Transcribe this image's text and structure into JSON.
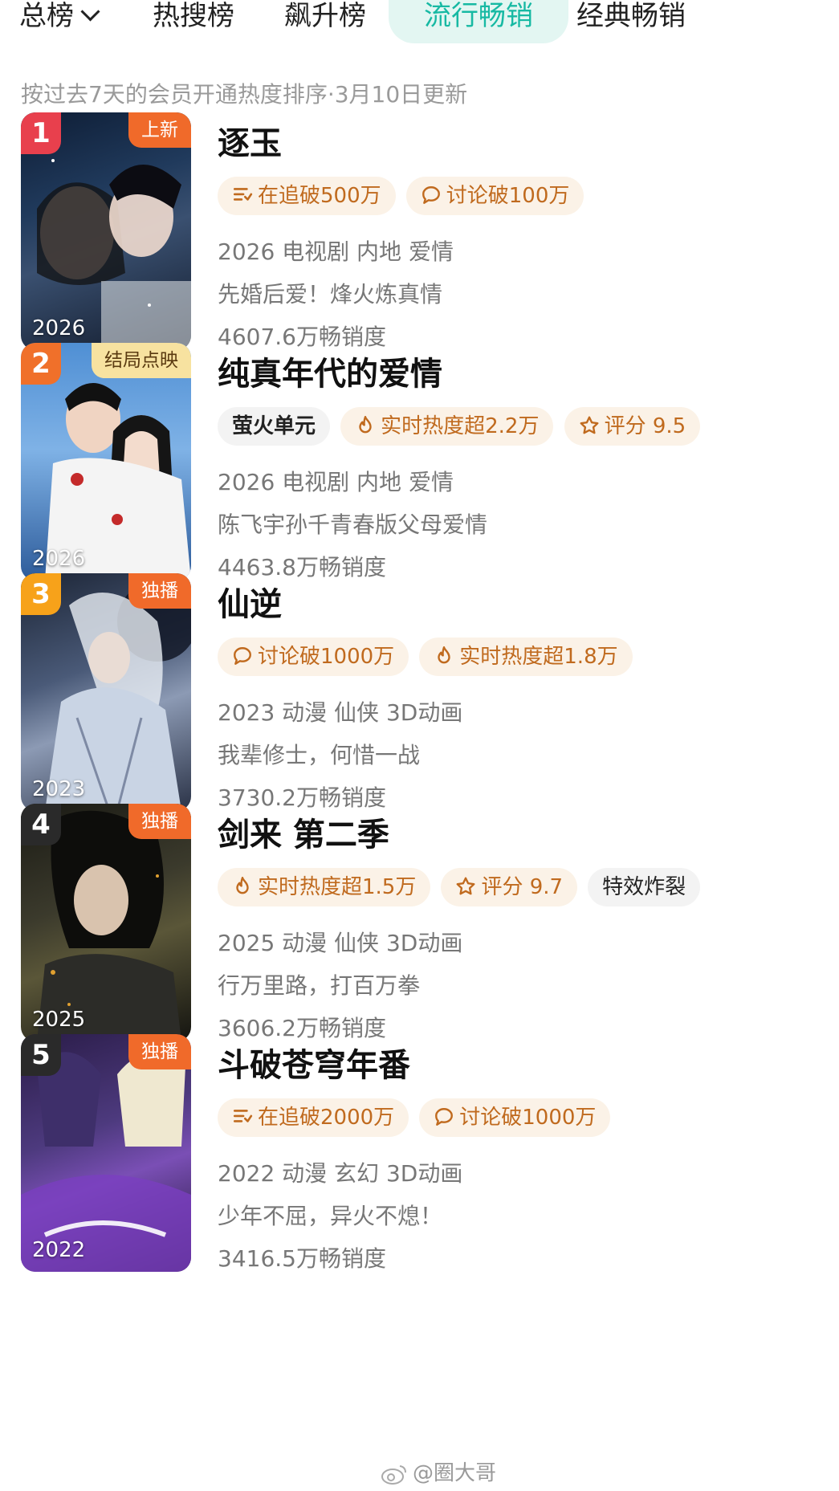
{
  "tabs": {
    "main": "总榜",
    "items": [
      "热搜榜",
      "飙升榜",
      "流行畅销",
      "经典畅销"
    ],
    "active": "流行畅销"
  },
  "subtitle": "按过去7天的会员开通热度排序·3月10日更新",
  "ranking": [
    {
      "rank": "1",
      "badge": "上新",
      "year": "2026",
      "title": "逐玉",
      "chips": [
        {
          "icon": "list-icon",
          "text": "在追破500万"
        },
        {
          "icon": "comment-icon",
          "text": "讨论破100万"
        }
      ],
      "info": "2026 电视剧 内地 爱情",
      "desc": "先婚后爱！烽火炼真情",
      "sales": "4607.6万畅销度"
    },
    {
      "rank": "2",
      "badge": "结局点映",
      "year": "2026",
      "title": "纯真年代的爱情",
      "chips": [
        {
          "icon": "yinghuo-logo-icon",
          "text": "萤火单元"
        },
        {
          "icon": "flame-icon",
          "text": "实时热度超2.2万"
        },
        {
          "icon": "star-icon",
          "text": "评分 9.5"
        }
      ],
      "info": "2026 电视剧 内地 爱情",
      "desc": "陈飞宇孙千青春版父母爱情",
      "sales": "4463.8万畅销度"
    },
    {
      "rank": "3",
      "badge": "独播",
      "year": "2023",
      "title": "仙逆",
      "chips": [
        {
          "icon": "comment-icon",
          "text": "讨论破1000万"
        },
        {
          "icon": "flame-icon",
          "text": "实时热度超1.8万"
        }
      ],
      "info": "2023 动漫 仙侠 3D动画",
      "desc": "我辈修士，何惜一战",
      "sales": "3730.2万畅销度"
    },
    {
      "rank": "4",
      "badge": "独播",
      "year": "2025",
      "title": "剑来 第二季",
      "chips": [
        {
          "icon": "flame-icon",
          "text": "实时热度超1.5万"
        },
        {
          "icon": "star-icon",
          "text": "评分 9.7"
        },
        {
          "icon": "",
          "text": "特效炸裂"
        }
      ],
      "info": "2025 动漫 仙侠 3D动画",
      "desc": "行万里路，打百万拳",
      "sales": "3606.2万畅销度"
    },
    {
      "rank": "5",
      "badge": "独播",
      "year": "2022",
      "title": "斗破苍穹年番",
      "chips": [
        {
          "icon": "list-icon",
          "text": "在追破2000万"
        },
        {
          "icon": "comment-icon",
          "text": "讨论破1000万"
        }
      ],
      "info": "2022 动漫 玄幻 3D动画",
      "desc": "少年不屈，异火不熄！",
      "sales": "3416.5万畅销度"
    }
  ],
  "watermark": "@圈大哥",
  "colors": {
    "accent": "#17b9a3",
    "rank1": "#e8404d",
    "rank2": "#f0702a",
    "rank3": "#f7a21a",
    "rank_other": "#2a2a2a",
    "badge_orange": "#f06a2a",
    "badge_yellow": "#f7e2a0",
    "chip_text": "#c06a1e",
    "chip_bg": "#fbf2e7"
  }
}
